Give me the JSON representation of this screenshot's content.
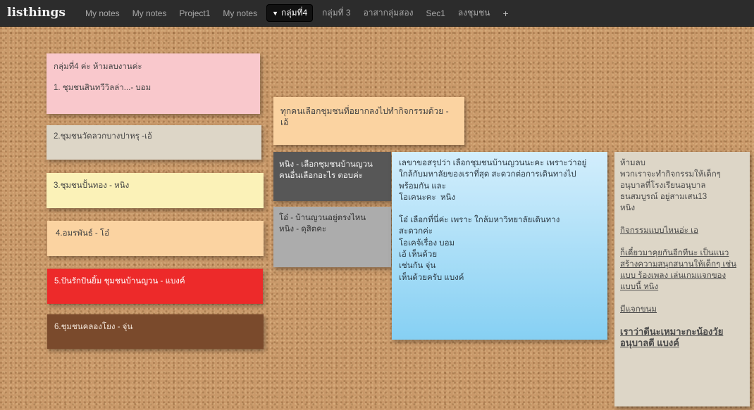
{
  "app": {
    "brand": "listhings"
  },
  "tabs": [
    {
      "label": "My notes"
    },
    {
      "label": "My notes"
    },
    {
      "label": "Project1"
    },
    {
      "label": "My notes"
    },
    {
      "label": "กลุ่มที่4",
      "active": true
    },
    {
      "label": "กลุ่มที่ 3"
    },
    {
      "label": "อาสากลุ่มสอง"
    },
    {
      "label": "Sec1"
    },
    {
      "label": "ลงชุมชน"
    },
    {
      "label": "+"
    }
  ],
  "icons": {
    "active_tab_caret": "caret-down-icon"
  },
  "notes": {
    "pink": {
      "line1": "กลุ่มที่4 ค่ะ ห้ามลบงานค่ะ",
      "line2": "1. ชุมชนสินทวีวิลล่า...- บอม",
      "color": "#f9c8cc"
    },
    "gray_top": {
      "text": "2.ชุมชนวัดลวกบางปาหรุ -เอ้",
      "color": "#ddd6c7"
    },
    "yellow": {
      "text": "3.ชุมชนปั้นทอง - หนิง",
      "color": "#fbf2b8"
    },
    "peach_left": {
      "text": "4.อมรพันธ์ - โอ๋",
      "color": "#fbd3a1"
    },
    "red": {
      "text": "5.ปันรักปันยิ้ม ชุมชนบ้านญวน - แบงค์",
      "color": "#ed2a2a"
    },
    "brown": {
      "text": "6.ชุมชนคลองโยง - จุ่น",
      "color": "#7a4a2c"
    },
    "peach_mid": {
      "text": "ทุกคนเลือกชุมชนที่อยากลงไปทำกิจกรรมด้วย -\nเอ้",
      "color": "#fbd3a1"
    },
    "dark": {
      "text": "หนิง - เลือกชุมชนบ้านญวน\nคนอื่นเลือกอะไร ตอบค่ะ",
      "color": "#575757"
    },
    "silver": {
      "text": "โอ๋ - บ้านญวนอยู่ตรงไหน\nหนิง - ดุสิตคะ",
      "color": "#acacac"
    },
    "blue": {
      "lines": [
        "เลขาขอสรุปว่า เลือกชุมชนบ้านญวนนะคะ เพราะว่าอยู่",
        "ใกล้กับมหาลัยของเราที่สุด สะดวกต่อการเดินทางไป",
        "พร้อมกัน และ",
        "โอเคนะคะ  หนิง",
        "",
        "โอ๋ เลือกที่นี่ค่ะ เพราะ ใกล้มหาวิทยาลัยเดินทาง",
        "สะดวกค่ะ",
        "โอเคจ้เรื่อง บอม",
        "เอ้ เห็นด้วย",
        "เช่นกัน จุ่น",
        "เห็นด้วยครับ แบงค์"
      ],
      "color_top": "#d3eefc",
      "color_bottom": "#86d0f3"
    },
    "linen": {
      "intro": [
        "ห้ามลบ",
        "พวกเราจะทำกิจกรรมให้เด็กๆ",
        "อนุบาลที่โรงเรียนอนุบาล",
        "ธนสมบูรณ์ อยู่สามเสน13",
        "หนิง"
      ],
      "q1": "กิจกรรมแบบไหนอ่ะ เอ",
      "q2": [
        "ก็เดี๋ยวมาคุยกันอีกทีนะ เป็นแนว",
        "สร้างความสนุกสนานให้เด็กๆ เช่น",
        "แบบ ร้องเพลง เล่นเกมแจกของ",
        "แบบนี้ หนิง"
      ],
      "q3": "มีแจกขนม",
      "q4": [
        "เราว่าดีนะเหมาะกะน้องวัย",
        "อนุบาลดี แบงค์"
      ],
      "color": "#ddd6c7"
    }
  }
}
